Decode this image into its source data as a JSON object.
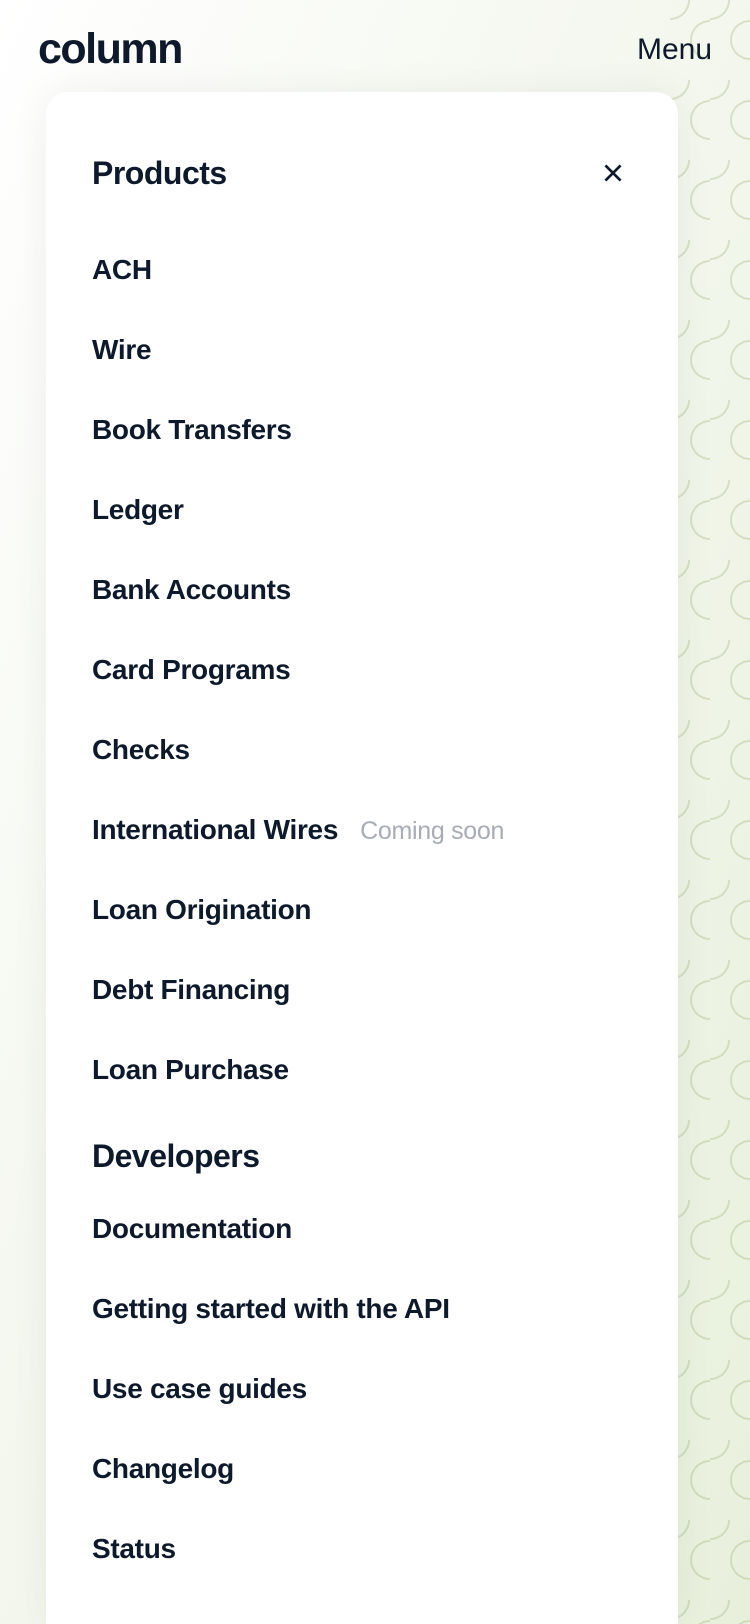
{
  "header": {
    "logo": "column",
    "menu_label": "Menu"
  },
  "panel": {
    "sections": [
      {
        "title": "Products",
        "items": [
          {
            "label": "ACH",
            "badge": ""
          },
          {
            "label": "Wire",
            "badge": ""
          },
          {
            "label": "Book Transfers",
            "badge": ""
          },
          {
            "label": "Ledger",
            "badge": ""
          },
          {
            "label": "Bank Accounts",
            "badge": ""
          },
          {
            "label": "Card Programs",
            "badge": ""
          },
          {
            "label": "Checks",
            "badge": ""
          },
          {
            "label": "International Wires",
            "badge": "Coming soon"
          },
          {
            "label": "Loan Origination",
            "badge": ""
          },
          {
            "label": "Debt Financing",
            "badge": ""
          },
          {
            "label": "Loan Purchase",
            "badge": ""
          }
        ]
      },
      {
        "title": "Developers",
        "items": [
          {
            "label": "Documentation",
            "badge": ""
          },
          {
            "label": "Getting started with the API",
            "badge": ""
          },
          {
            "label": "Use case guides",
            "badge": ""
          },
          {
            "label": "Changelog",
            "badge": ""
          },
          {
            "label": "Status",
            "badge": ""
          }
        ]
      }
    ]
  }
}
